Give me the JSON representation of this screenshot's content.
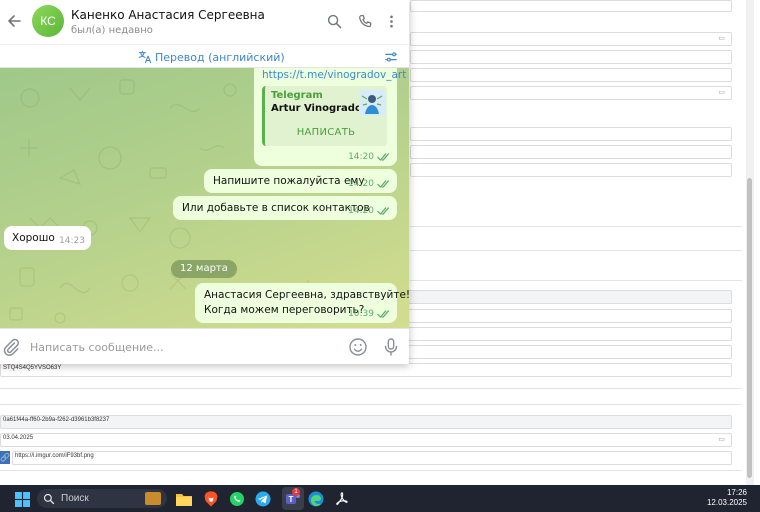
{
  "background_form": {
    "field_texts": {
      "code": "STQ4S4Q5YVSO63Y",
      "uuid": "0a61f44a-ff60-2b9a-f262-d3961b3f8237",
      "date": "03.04.2025",
      "url": "https://i.imgur.com/iF93bf.png"
    }
  },
  "telegram": {
    "contact": {
      "initials": "КС",
      "name": "Каненко Анастасия Сергеевна",
      "status": "был(а) недавно"
    },
    "translate_bar": {
      "label": "Перевод (английский)"
    },
    "messages": {
      "link_msg": {
        "url": "https://t.me/vinogradov_art",
        "preview_site": "Telegram",
        "preview_title": "Artur Vinogradov",
        "preview_button": "НАПИСАТЬ",
        "time": "14:20"
      },
      "m1": {
        "text": "Напишите пожалуйста ему",
        "time": "14:20"
      },
      "m2": {
        "text": "Или добавьте в список контактов",
        "time": "14:20"
      },
      "m3": {
        "text": "Хорошо",
        "time": "14:23"
      },
      "date_separator": "12 марта",
      "m4": {
        "line1": "Анастасия Сергеевна, здравствуйте!",
        "line2": "Когда можем переговорить?",
        "time": "10:39"
      }
    },
    "composer": {
      "placeholder": "Написать сообщение..."
    }
  },
  "taskbar": {
    "search_placeholder": "Поиск",
    "apps": [
      "windows-start",
      "file-explorer",
      "brave",
      "whatsapp",
      "telegram",
      "teams",
      "edge",
      "acrobat"
    ],
    "teams_badge": "1",
    "time": "17:26",
    "date": "12.03.2025"
  },
  "colors": {
    "outgoing_bubble": "#eeffde",
    "accent_blue": "#3f86c9",
    "check_green": "#5fac6a"
  }
}
